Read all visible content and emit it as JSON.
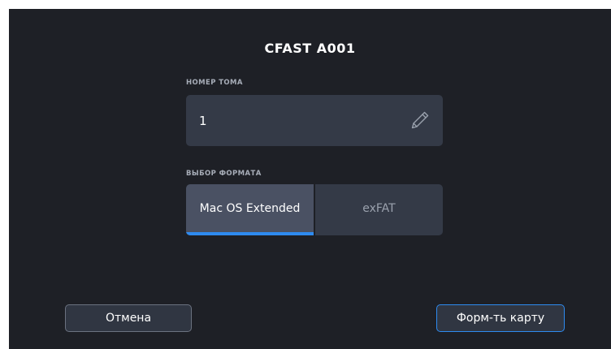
{
  "dialog": {
    "title": "CFAST A001"
  },
  "volume": {
    "label": "НОМЕР ТОМА",
    "value": "1",
    "edit_icon": "pencil-icon"
  },
  "format": {
    "label": "ВЫБОР ФОРМАТА",
    "options": [
      {
        "label": "Mac OS Extended",
        "selected": true
      },
      {
        "label": "exFAT",
        "selected": false
      }
    ]
  },
  "buttons": {
    "cancel_label": "Отмена",
    "format_label": "Форм-ть карту"
  },
  "colors": {
    "background": "#1e2026",
    "field": "#343a47",
    "selected_option": "#4a5163",
    "accent": "#2e8bf0",
    "muted_text": "#9aa1ad"
  }
}
